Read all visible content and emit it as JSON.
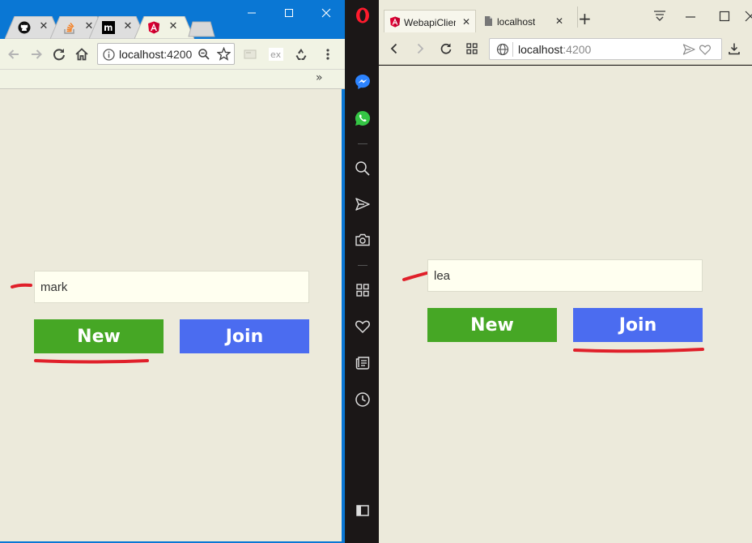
{
  "chrome": {
    "tabs": [
      {
        "icon": "github-icon",
        "active": false
      },
      {
        "icon": "stackoverflow-icon",
        "active": false
      },
      {
        "icon": "m-logo-icon",
        "active": false
      },
      {
        "icon": "angular-icon",
        "active": true
      }
    ],
    "url_host": "localhost",
    "url_port": ":4200",
    "bookmarks_overflow": "»",
    "app": {
      "name_value": "mark",
      "new_label": "New",
      "join_label": "Join",
      "highlighted": "new"
    }
  },
  "opera": {
    "tabs": [
      {
        "title": "WebapiClien",
        "icon": "angular-icon",
        "active": true
      },
      {
        "title": "localhost",
        "icon": "page-icon",
        "active": false
      }
    ],
    "new_tab": "+",
    "url_host": "localhost",
    "url_port": ":4200",
    "app": {
      "name_value": "lea",
      "new_label": "New",
      "join_label": "Join",
      "highlighted": "join"
    }
  },
  "colors": {
    "chrome_frame": "#0a77d4",
    "page_background": "#eceadb",
    "new_button": "#46a725",
    "join_button": "#4b6cf0",
    "annotation": "#e0202a",
    "opera_sidebar": "#1b1717"
  }
}
